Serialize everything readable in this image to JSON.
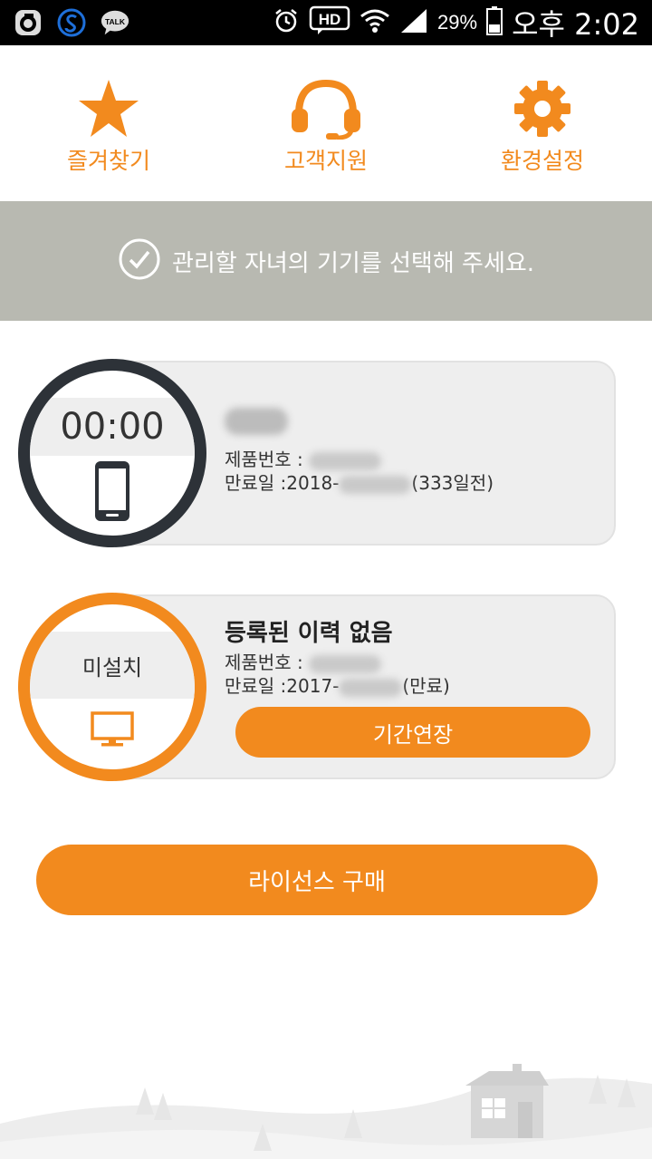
{
  "status_bar": {
    "icons_left": [
      "o-app-icon",
      "s-app-icon",
      "kakaotalk-icon"
    ],
    "talk_label": "TALK",
    "hd_label": "HD",
    "battery": "29%",
    "time": "오후 2:02"
  },
  "nav": [
    {
      "label": "즐겨찾기",
      "icon": "star-icon"
    },
    {
      "label": "고객지원",
      "icon": "headset-icon"
    },
    {
      "label": "환경설정",
      "icon": "gear-icon"
    }
  ],
  "banner": {
    "text": "관리할 자녀의 기기를 선택해 주세요."
  },
  "devices": [
    {
      "ring_text": "00:00",
      "name": "",
      "product_label": "제품번호 :",
      "expiry_label": "만료일 :",
      "expiry_visible": "2018-",
      "expiry_suffix": "(333일전)",
      "device_icon": "smartphone-icon"
    },
    {
      "ring_text": "미설치",
      "name": "등록된 이력 없음",
      "product_label": "제품번호 :",
      "expiry_label": "만료일 :",
      "expiry_visible": "2017-",
      "expiry_suffix": "(만료)",
      "device_icon": "monitor-icon",
      "extend_label": "기간연장"
    }
  ],
  "buy_button": "라이선스 구매",
  "colors": {
    "accent": "#f28a1e",
    "banner": "#b8b9b1",
    "dark_ring": "#2d3238",
    "card_bg": "#eeeeee"
  }
}
